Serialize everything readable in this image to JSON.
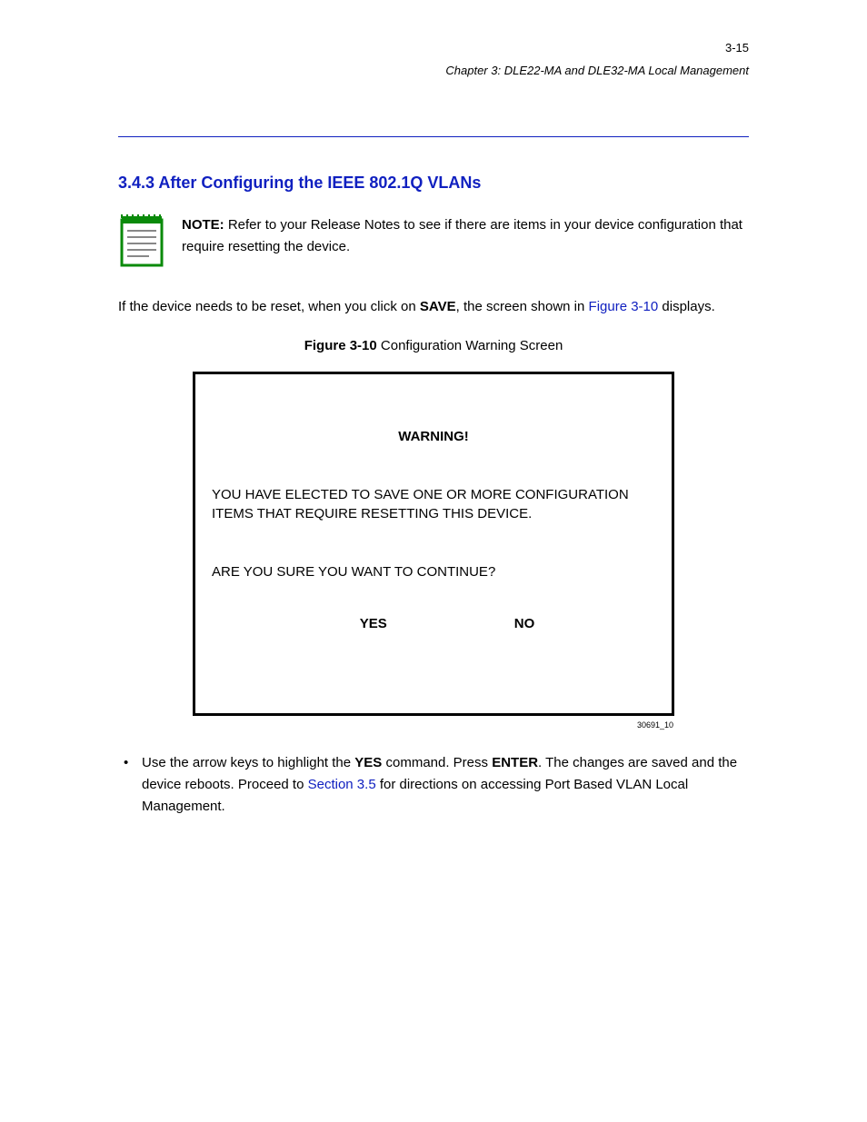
{
  "header": {
    "page_number_top": "3-15",
    "right_text": "Chapter 3: DLE22-MA and DLE32-MA Local Management"
  },
  "subsection_title": "3.4.3 After Configuring the IEEE 802.1Q VLANs",
  "note": {
    "label": "NOTE:",
    "text": "Refer to your Release Notes to see if there are items in your device configuration that require resetting the device."
  },
  "para1": {
    "prefix": "If the device needs to be reset, when you click on ",
    "bold1": "SAVE",
    "mid": ", the screen shown in ",
    "link": "Figure 3-10",
    "suffix": " displays."
  },
  "figure": {
    "caption_num": "Figure 3-10",
    "caption_text": "Configuration Warning Screen",
    "warning_title": "WARNING!",
    "warning_line1": "YOU HAVE ELECTED TO SAVE ONE OR MORE CONFIGURATION ITEMS THAT REQUIRE RESETTING THIS DEVICE.",
    "warning_line2": "ARE YOU SURE YOU WANT TO CONTINUE?",
    "yes": "YES",
    "no": "NO",
    "code": "30691_10"
  },
  "bullet": {
    "prefix": "Use the arrow keys to highlight the ",
    "bold1": "YES",
    "mid1": " command. Press ",
    "bold2": "ENTER",
    "mid2": ". The changes are saved and the device reboots. Proceed to ",
    "link": "Section 3.5",
    "suffix": " for directions on accessing Port Based VLAN Local Management."
  }
}
